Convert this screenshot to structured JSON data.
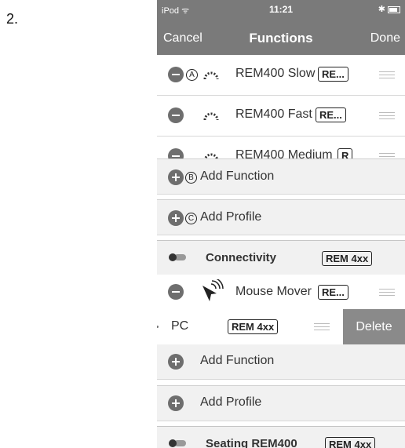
{
  "step_label": "2.",
  "status": {
    "device": "iPod",
    "time": "11:21"
  },
  "nav": {
    "cancel": "Cancel",
    "title": "Functions",
    "done": "Done"
  },
  "rows": [
    {
      "markers": "A",
      "label": "REM400 Slow",
      "tag": "RE..."
    },
    {
      "label": "REM400 Fast",
      "tag": "RE..."
    },
    {
      "label": "REM400 Medium",
      "tag": "R"
    },
    {
      "marker": "B",
      "label": "Add Function"
    },
    {
      "marker": "C",
      "label": "Add Profile"
    },
    {
      "label": "Connectivity",
      "tag": "REM 4xx"
    },
    {
      "label": "Mouse Mover",
      "tag": "RE..."
    },
    {
      "label": "PC",
      "tag": "REM 4xx",
      "action": "Delete"
    },
    {
      "label": "Add Function"
    },
    {
      "label": "Add Profile"
    },
    {
      "label": "Seating REM400",
      "tag": "REM 4xx"
    }
  ],
  "icons": {
    "status_wifi": "wifi-icon",
    "status_bluetooth": "bluetooth-icon",
    "status_battery": "battery-icon",
    "speed": "speedometer-icon",
    "connectivity": "toggle-switch-icon",
    "mouse": "mouse-pointer-icon",
    "reorder": "reorder-handle-icon"
  },
  "colors": {
    "nav_bar": "#7a7a7a",
    "delete_button": "#8a8a8a",
    "section_bg": "#f1f1f1"
  }
}
